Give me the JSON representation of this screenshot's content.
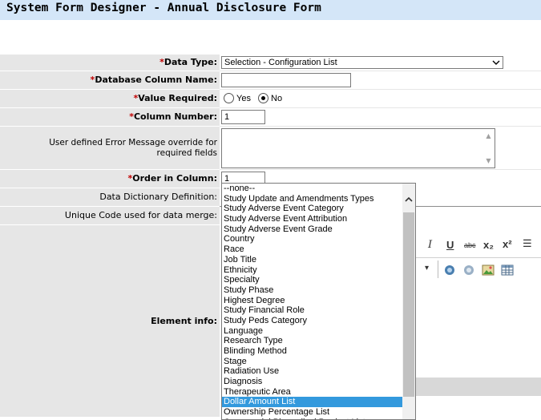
{
  "header": {
    "title": "System Form Designer - Annual Disclosure Form"
  },
  "form": {
    "required_mark": "*",
    "data_type": {
      "label": "Data Type:",
      "value": "Selection - Configuration List"
    },
    "db_column": {
      "label": "Database Column Name:",
      "value": ""
    },
    "value_required": {
      "label": "Value Required:",
      "yes": "Yes",
      "no": "No",
      "selected": "No"
    },
    "column_number": {
      "label": "Column Number:",
      "value": "1"
    },
    "error_message": {
      "label": "User defined Error Message override for required fields",
      "value": ""
    },
    "order_in_column": {
      "label": "Order in Column:",
      "value": "1"
    },
    "dictionary_def": {
      "label": "Data Dictionary Definition:"
    },
    "unique_code": {
      "label": "Unique Code used for data merge:"
    },
    "element_info": {
      "label": "Element info:"
    }
  },
  "toolbar": {
    "italic": "I",
    "underline": "U",
    "strike": "abc",
    "subscript": "x₂",
    "superscript": "x²",
    "list": "☰",
    "dropdown_arrow": "▾"
  },
  "dropdown": {
    "options": [
      "--none--",
      "Study Update and Amendments Types",
      "Study Adverse Event Category",
      "Study Adverse Event Attribution",
      "Study Adverse Event Grade",
      "Country",
      "Race",
      "Job Title",
      "Ethnicity",
      "Specialty",
      "Study Phase",
      "Highest Degree",
      "Study Financial Role",
      "Study Peds Category",
      "Language",
      "Research Type",
      "Blinding Method",
      "Stage",
      "Radiation Use",
      "Diagnosis",
      "Therapeutic Area",
      "Dollar Amount List",
      "Ownership Percentage List",
      "Commercial Biomedical Product List"
    ],
    "selected": "Dollar Amount List"
  }
}
